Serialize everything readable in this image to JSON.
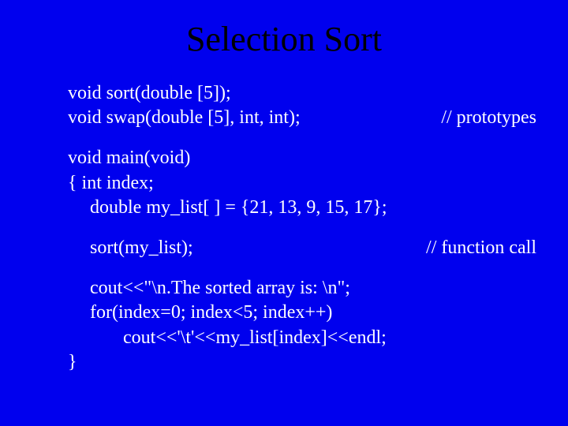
{
  "title": "Selection Sort",
  "l1": "void sort(double [5]);",
  "l2_left": "void swap(double [5], int, int);",
  "l2_right": "// prototypes",
  "l3": "void main(void)",
  "l4": "{  int index;",
  "l5": "double  my_list[ ] = {21, 13, 9, 15, 17};",
  "l6_left": "sort(my_list);",
  "l6_right": "// function call",
  "l7": "cout<<\"\\n.The sorted array is: \\n\";",
  "l8": "for(index=0;  index<5; index++)",
  "l9": "cout<<'\\t'<<my_list[index]<<endl;",
  "l10": "}"
}
